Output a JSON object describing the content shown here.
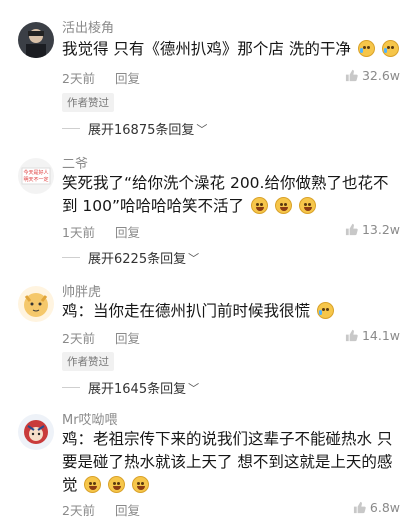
{
  "comments": [
    {
      "username": "活出棱角",
      "text": "我觉得 只有《德州扒鸡》那个店 洗的干净",
      "emojis": [
        "tear",
        "tear"
      ],
      "time": "2天前",
      "reply_label": "回复",
      "likes": "32.6w",
      "author_liked": "作者赞过",
      "expand_label": "展开16875条回复"
    },
    {
      "username": "二爷",
      "avatar_text": "今天是好人 明天不一定",
      "text": "笑死我了“给你洗个澡花 200.给你做熟了也花不到 100”哈哈哈哈笑不活了",
      "emojis": [
        "laugh",
        "laugh",
        "laugh"
      ],
      "time": "1天前",
      "reply_label": "回复",
      "likes": "13.2w",
      "expand_label": "展开6225条回复"
    },
    {
      "username": "帅胖虎",
      "text": "鸡：当你走在德州扒门前时候我很慌",
      "emojis": [
        "tear"
      ],
      "time": "2天前",
      "reply_label": "回复",
      "likes": "14.1w",
      "author_liked": "作者赞过",
      "expand_label": "展开1645条回复"
    },
    {
      "username": "Mr哎呦喂",
      "text": "鸡：老祖宗传下来的说我们这辈子不能碰热水 只要是碰了热水就该上天了 想不到这就是上天的感觉",
      "emojis": [
        "laugh",
        "laugh",
        "laugh"
      ],
      "time": "2天前",
      "reply_label": "回复",
      "likes": "6.8w"
    }
  ]
}
